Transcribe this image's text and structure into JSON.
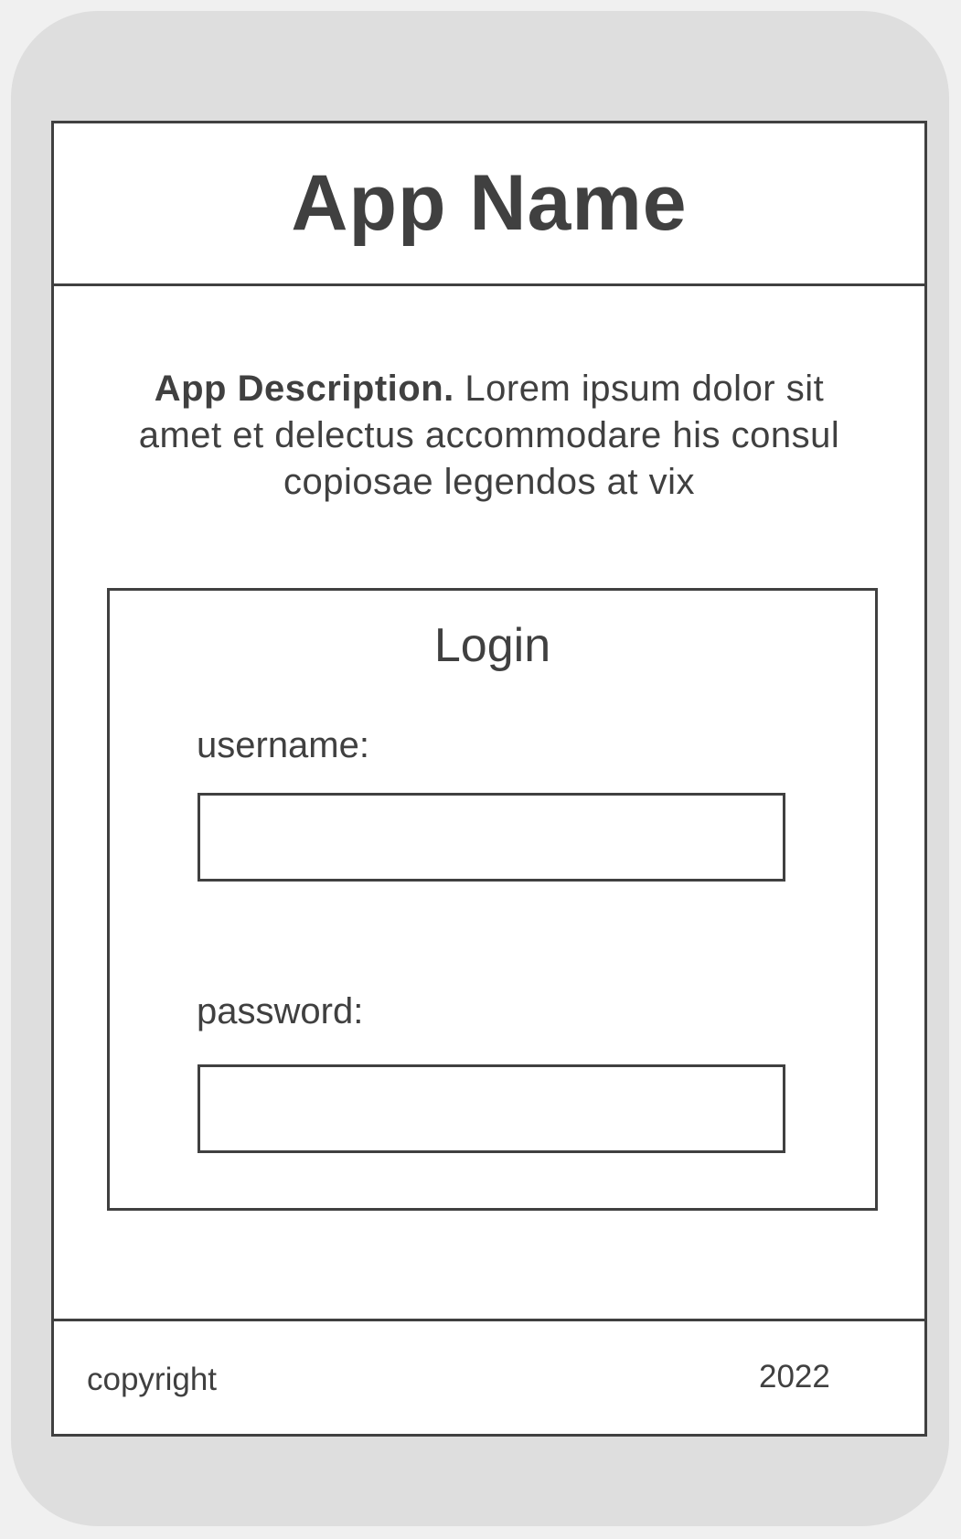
{
  "header": {
    "app_name": "App Name"
  },
  "description": {
    "bold_prefix": "App Description.",
    "body": " Lorem ipsum dolor sit amet et delectus accommodare his consul copiosae legendos at vix"
  },
  "login": {
    "title": "Login",
    "username_label": "username:",
    "username_value": "",
    "password_label": "password:",
    "password_value": ""
  },
  "footer": {
    "copyright": "copyright",
    "year": "2022"
  },
  "colors": {
    "frame": "#dedede",
    "stroke": "#404040",
    "screen": "#ffffff"
  }
}
